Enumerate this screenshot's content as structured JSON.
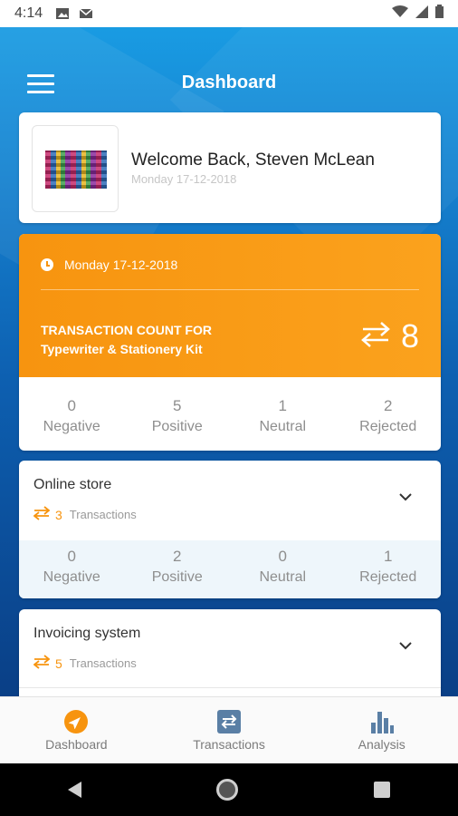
{
  "status_bar": {
    "time": "4:14",
    "icons": [
      "image-icon",
      "gmail-icon",
      "wifi-icon",
      "signal-icon",
      "battery-icon"
    ]
  },
  "app_bar": {
    "title": "Dashboard",
    "menu_icon": "hamburger-menu-icon"
  },
  "welcome": {
    "text": "Welcome Back, Steven McLean",
    "date": "Monday 17-12-2018"
  },
  "summary": {
    "date": "Monday 17-12-2018",
    "label_line1": "TRANSACTION COUNT FOR",
    "label_line2": "Typewriter & Stationery Kit",
    "count": "8",
    "stats": [
      {
        "value": "0",
        "label": "Negative"
      },
      {
        "value": "5",
        "label": "Positive"
      },
      {
        "value": "1",
        "label": "Neutral"
      },
      {
        "value": "2",
        "label": "Rejected"
      }
    ]
  },
  "stores": [
    {
      "name": "Online store",
      "tx_count": "3",
      "tx_label": "Transactions",
      "stats": [
        {
          "value": "0",
          "label": "Negative"
        },
        {
          "value": "2",
          "label": "Positive"
        },
        {
          "value": "0",
          "label": "Neutral"
        },
        {
          "value": "1",
          "label": "Rejected"
        }
      ]
    },
    {
      "name": "Invoicing system",
      "tx_count": "5",
      "tx_label": "Transactions"
    }
  ],
  "bottom_nav": [
    {
      "label": "Dashboard",
      "icon": "compass-icon"
    },
    {
      "label": "Transactions",
      "icon": "swap-icon"
    },
    {
      "label": "Analysis",
      "icon": "bar-chart-icon"
    }
  ],
  "colors": {
    "accent": "#f7940f",
    "header_bg": "#1582d0",
    "nav_icon": "#5a7fa5"
  }
}
